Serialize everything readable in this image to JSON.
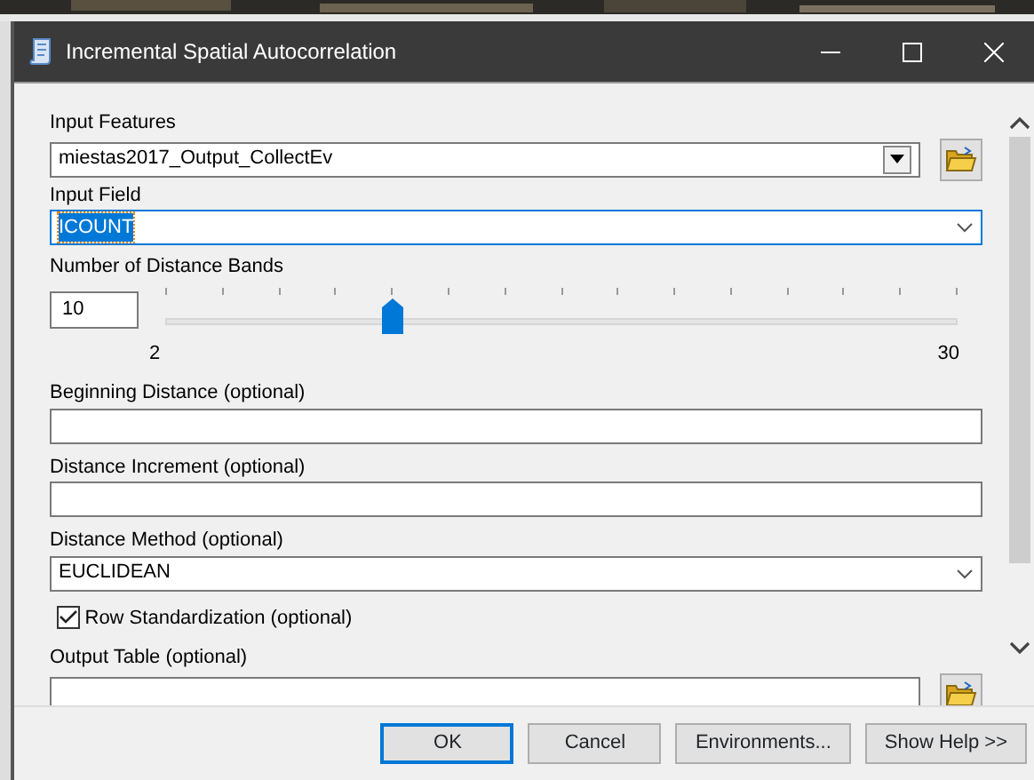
{
  "window": {
    "title": "Incremental Spatial Autocorrelation"
  },
  "input_features": {
    "label": "Input Features",
    "value": "miestas2017_Output_CollectEv"
  },
  "input_field": {
    "label": "Input Field",
    "value": "ICOUNT",
    "focused": true
  },
  "distance_bands": {
    "label": "Number of Distance Bands",
    "value": "10",
    "level": 0.286,
    "min_label": "2",
    "max_label": "30"
  },
  "beginning_distance": {
    "label": "Beginning Distance (optional)"
  },
  "distance_increment": {
    "label": "Distance Increment (optional)"
  },
  "distance_method": {
    "label": "Distance Method (optional)",
    "value": "EUCLIDEAN"
  },
  "row_standardization": {
    "label": "Row Standardization (optional)",
    "checked": true
  },
  "output_table": {
    "label": "Output Table (optional)"
  },
  "buttons": [
    {
      "label": "OK",
      "default": true
    },
    {
      "label": "Cancel",
      "default": false
    },
    {
      "label": "Environments...",
      "default": false
    },
    {
      "label": "Show Help >>",
      "default": false
    }
  ]
}
